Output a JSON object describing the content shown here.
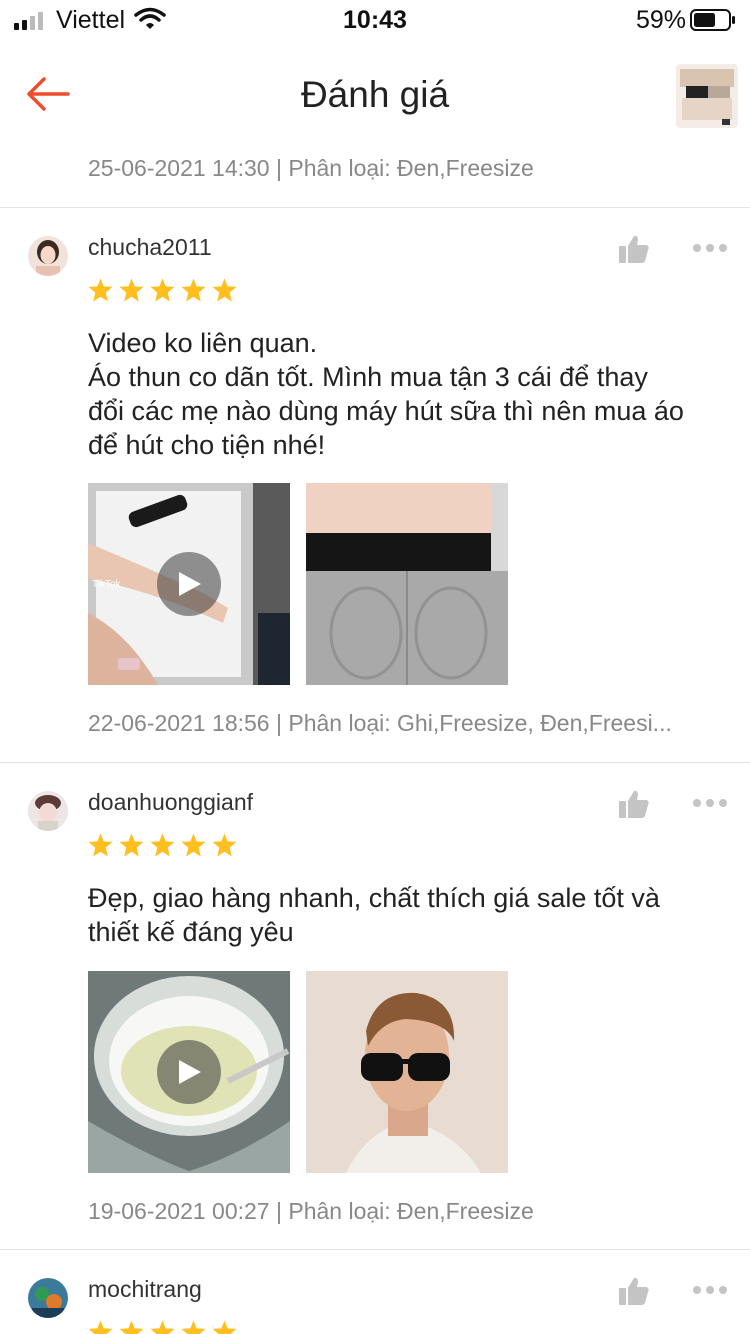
{
  "status_bar": {
    "carrier": "Viettel",
    "time": "10:43",
    "battery_percent": "59%"
  },
  "header": {
    "title": "Đánh giá",
    "back_icon": "arrow-left-icon",
    "accent_color": "#ee4d2d"
  },
  "top_meta": "25-06-2021 14:30 | Phân loại: Đen,Freesize",
  "reviews": [
    {
      "username": "chucha2011",
      "stars": 5,
      "text_lines": [
        "Video ko liên quan.",
        "Áo thun co dãn tốt. Mình mua tận 3 cái để thay",
        "đổi các mẹ nào dùng máy hút sữa thì nên mua áo",
        "để hút cho tiện nhé!"
      ],
      "media_label": "TikTok",
      "meta": "22-06-2021 18:56 | Phân loại: Ghi,Freesize, Đen,Freesi..."
    },
    {
      "username": "doanhuonggianf",
      "stars": 5,
      "text_lines": [
        "Đẹp, giao hàng nhanh, chất thích giá sale tốt và",
        "thiết kế đáng yêu"
      ],
      "meta": "19-06-2021 00:27 | Phân loại: Đen,Freesize"
    },
    {
      "username": "mochitrang",
      "stars": 5
    }
  ],
  "colors": {
    "star": "#ffbf1f",
    "icon_gray": "#c4c4c4",
    "meta_text": "#888888"
  }
}
